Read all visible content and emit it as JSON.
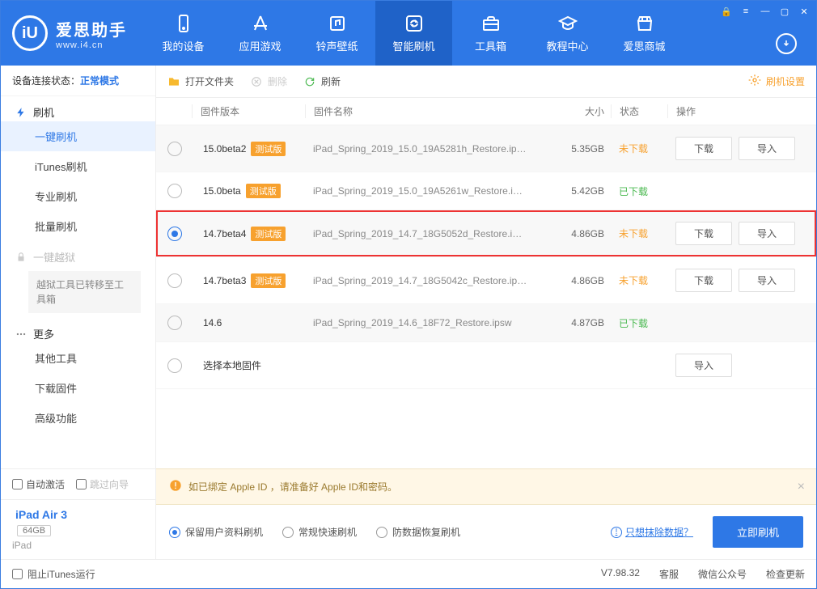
{
  "brand": {
    "zh": "爱思助手",
    "en": "www.i4.cn"
  },
  "nav": {
    "device": "我的设备",
    "apps": "应用游戏",
    "ringtone": "铃声壁纸",
    "flash": "智能刷机",
    "toolbox": "工具箱",
    "tutorial": "教程中心",
    "mall": "爱思商城"
  },
  "sidebar": {
    "status_label": "设备连接状态：",
    "status_value": "正常模式",
    "section_flash": "刷机",
    "items": {
      "oneclick": "一键刷机",
      "itunes": "iTunes刷机",
      "pro": "专业刷机",
      "batch": "批量刷机"
    },
    "section_jb": "一键越狱",
    "jb_note": "越狱工具已转移至工具箱",
    "section_more": "更多",
    "more": {
      "other": "其他工具",
      "dlfw": "下载固件",
      "adv": "高级功能"
    },
    "auto_activate": "自动激活",
    "skip_guide": "跳过向导",
    "device_name": "iPad Air 3",
    "device_cap": "64GB",
    "device_type": "iPad"
  },
  "toolbar": {
    "open": "打开文件夹",
    "delete": "删除",
    "refresh": "刷新",
    "settings": "刷机设置"
  },
  "columns": {
    "ver": "固件版本",
    "name": "固件名称",
    "size": "大小",
    "status": "状态",
    "action": "操作"
  },
  "badge_beta": "测试版",
  "rows": [
    {
      "selected": false,
      "ver": "15.0beta2",
      "beta": true,
      "name": "iPad_Spring_2019_15.0_19A5281h_Restore.ip…",
      "size": "5.35GB",
      "status": "未下载",
      "status_ok": false,
      "dl": true,
      "imp": true
    },
    {
      "selected": false,
      "ver": "15.0beta",
      "beta": true,
      "name": "iPad_Spring_2019_15.0_19A5261w_Restore.i…",
      "size": "5.42GB",
      "status": "已下载",
      "status_ok": true,
      "dl": false,
      "imp": false
    },
    {
      "selected": true,
      "ver": "14.7beta4",
      "beta": true,
      "name": "iPad_Spring_2019_14.7_18G5052d_Restore.i…",
      "size": "4.86GB",
      "status": "未下载",
      "status_ok": false,
      "dl": true,
      "imp": true,
      "highlight": true
    },
    {
      "selected": false,
      "ver": "14.7beta3",
      "beta": true,
      "name": "iPad_Spring_2019_14.7_18G5042c_Restore.ip…",
      "size": "4.86GB",
      "status": "未下载",
      "status_ok": false,
      "dl": true,
      "imp": true
    },
    {
      "selected": false,
      "ver": "14.6",
      "beta": false,
      "name": "iPad_Spring_2019_14.6_18F72_Restore.ipsw",
      "size": "4.87GB",
      "status": "已下载",
      "status_ok": true,
      "dl": false,
      "imp": false
    }
  ],
  "local_row": "选择本地固件",
  "btn_download": "下载",
  "btn_import": "导入",
  "tip": "如已绑定 Apple ID ，请准备好 Apple ID和密码。",
  "options": {
    "keep": "保留用户资料刷机",
    "normal": "常规快速刷机",
    "recover": "防数据恢复刷机"
  },
  "erase_link": "只想抹除数据？",
  "flash_now": "立即刷机",
  "footer": {
    "block_itunes": "阻止iTunes运行",
    "version": "V7.98.32",
    "service": "客服",
    "wechat": "微信公众号",
    "update": "检查更新"
  }
}
